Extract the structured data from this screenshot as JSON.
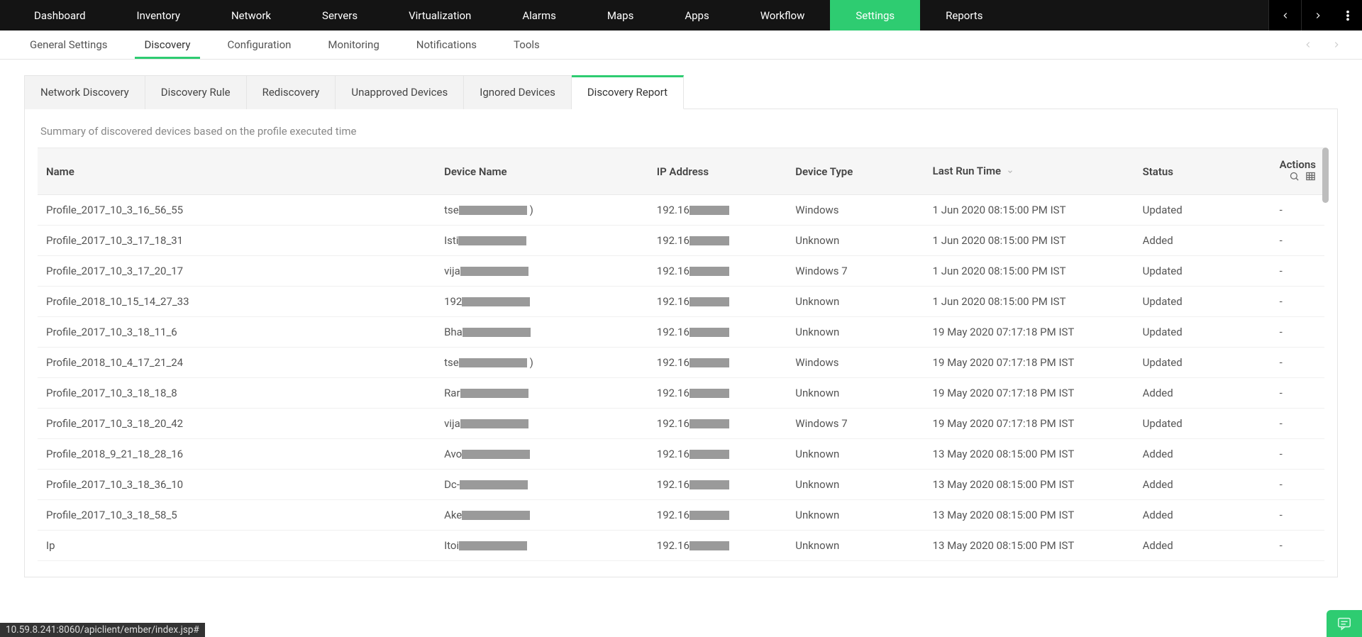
{
  "mainnav": {
    "items": [
      "Dashboard",
      "Inventory",
      "Network",
      "Servers",
      "Virtualization",
      "Alarms",
      "Maps",
      "Apps",
      "Workflow",
      "Settings",
      "Reports"
    ],
    "active_index": 9
  },
  "subnav": {
    "items": [
      "General Settings",
      "Discovery",
      "Configuration",
      "Monitoring",
      "Notifications",
      "Tools"
    ],
    "active_index": 1
  },
  "tabs": {
    "items": [
      "Network Discovery",
      "Discovery Rule",
      "Rediscovery",
      "Unapproved Devices",
      "Ignored Devices",
      "Discovery Report"
    ],
    "active_index": 5
  },
  "summary_text": "Summary of discovered devices based on the profile executed time",
  "table": {
    "headers": {
      "name": "Name",
      "device_name": "Device Name",
      "ip": "IP Address",
      "device_type": "Device Type",
      "last_run": "Last Run Time",
      "status": "Status",
      "actions": "Actions"
    },
    "rows": [
      {
        "name": "Profile_2017_10_3_16_56_55",
        "dev_pre": "tse",
        "dev_post": ")",
        "ip_pre": "192.16",
        "type": "Windows",
        "time": "1 Jun 2020 08:15:00 PM IST",
        "status": "Updated",
        "actions": "-"
      },
      {
        "name": "Profile_2017_10_3_17_18_31",
        "dev_pre": "Isti",
        "dev_post": "",
        "ip_pre": "192.16",
        "type": "Unknown",
        "time": "1 Jun 2020 08:15:00 PM IST",
        "status": "Added",
        "actions": "-"
      },
      {
        "name": "Profile_2017_10_3_17_20_17",
        "dev_pre": "vija",
        "dev_post": "",
        "ip_pre": "192.16",
        "type": "Windows 7",
        "time": "1 Jun 2020 08:15:00 PM IST",
        "status": "Updated",
        "actions": "-"
      },
      {
        "name": "Profile_2018_10_15_14_27_33",
        "dev_pre": "192",
        "dev_post": "",
        "ip_pre": "192.16",
        "type": "Unknown",
        "time": "1 Jun 2020 08:15:00 PM IST",
        "status": "Updated",
        "actions": "-"
      },
      {
        "name": "Profile_2017_10_3_18_11_6",
        "dev_pre": "Bha",
        "dev_post": "",
        "ip_pre": "192.16",
        "type": "Unknown",
        "time": "19 May 2020 07:17:18 PM IST",
        "status": "Updated",
        "actions": "-"
      },
      {
        "name": "Profile_2018_10_4_17_21_24",
        "dev_pre": "tse",
        "dev_post": ")",
        "ip_pre": "192.16",
        "type": "Windows",
        "time": "19 May 2020 07:17:18 PM IST",
        "status": "Updated",
        "actions": "-"
      },
      {
        "name": "Profile_2017_10_3_18_18_8",
        "dev_pre": "Rar",
        "dev_post": "",
        "ip_pre": "192.16",
        "type": "Unknown",
        "time": "19 May 2020 07:17:18 PM IST",
        "status": "Added",
        "actions": "-"
      },
      {
        "name": "Profile_2017_10_3_18_20_42",
        "dev_pre": "vija",
        "dev_post": "",
        "ip_pre": "192.16",
        "type": "Windows 7",
        "time": "19 May 2020 07:17:18 PM IST",
        "status": "Updated",
        "actions": "-"
      },
      {
        "name": "Profile_2018_9_21_18_28_16",
        "dev_pre": "Avo",
        "dev_post": "",
        "ip_pre": "192.16",
        "type": "Unknown",
        "time": "13 May 2020 08:15:00 PM IST",
        "status": "Added",
        "actions": "-"
      },
      {
        "name": "Profile_2017_10_3_18_36_10",
        "dev_pre": "Dc-",
        "dev_post": "",
        "ip_pre": "192.16",
        "type": "Unknown",
        "time": "13 May 2020 08:15:00 PM IST",
        "status": "Added",
        "actions": "-"
      },
      {
        "name": "Profile_2017_10_3_18_58_5",
        "dev_pre": "Ake",
        "dev_post": "",
        "ip_pre": "192.16",
        "type": "Unknown",
        "time": "13 May 2020 08:15:00 PM IST",
        "status": "Added",
        "actions": "-"
      },
      {
        "name": "Ip",
        "dev_pre": "Itoi",
        "dev_post": "",
        "ip_pre": "192.16",
        "type": "Unknown",
        "time": "13 May 2020 08:15:00 PM IST",
        "status": "Added",
        "actions": "-"
      }
    ]
  },
  "status_url": "10.59.8.241:8060/apiclient/ember/index.jsp#"
}
